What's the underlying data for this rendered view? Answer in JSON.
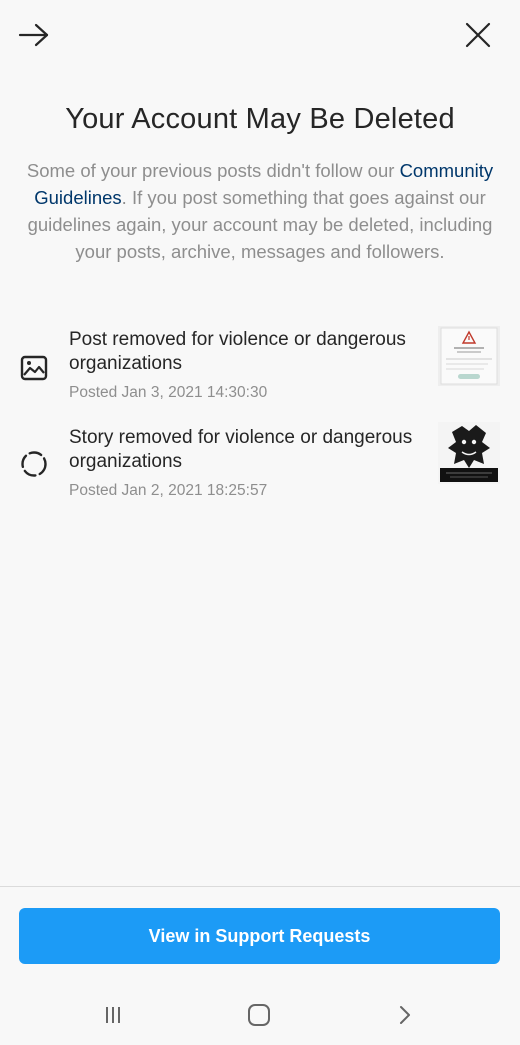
{
  "header": {
    "forward_icon": "arrow-right-icon",
    "close_icon": "close-icon"
  },
  "title": "Your Account May Be Deleted",
  "description": {
    "before_link": "Some of your previous posts didn't follow our ",
    "link_text": "Community Guidelines",
    "after_link": ". If you post something that goes against our guidelines again, your account may be deleted, including your posts, archive, messages and followers."
  },
  "violations": [
    {
      "icon": "image-icon",
      "title": "Post removed for violence or dangerous organizations",
      "date": "Posted Jan 3, 2021 14:30:30"
    },
    {
      "icon": "story-icon",
      "title": "Story removed for violence or dangerous organizations",
      "date": "Posted Jan 2, 2021 18:25:57"
    }
  ],
  "primary_button": {
    "label": "View in Support Requests",
    "color": "#1c9bf6"
  },
  "nav_bar": {
    "recent_icon": "recent-apps-icon",
    "home_icon": "home-icon",
    "back_icon": "back-icon"
  },
  "colors": {
    "link": "#00376b",
    "secondary_text": "#8e8e8e",
    "primary_text": "#262626"
  }
}
